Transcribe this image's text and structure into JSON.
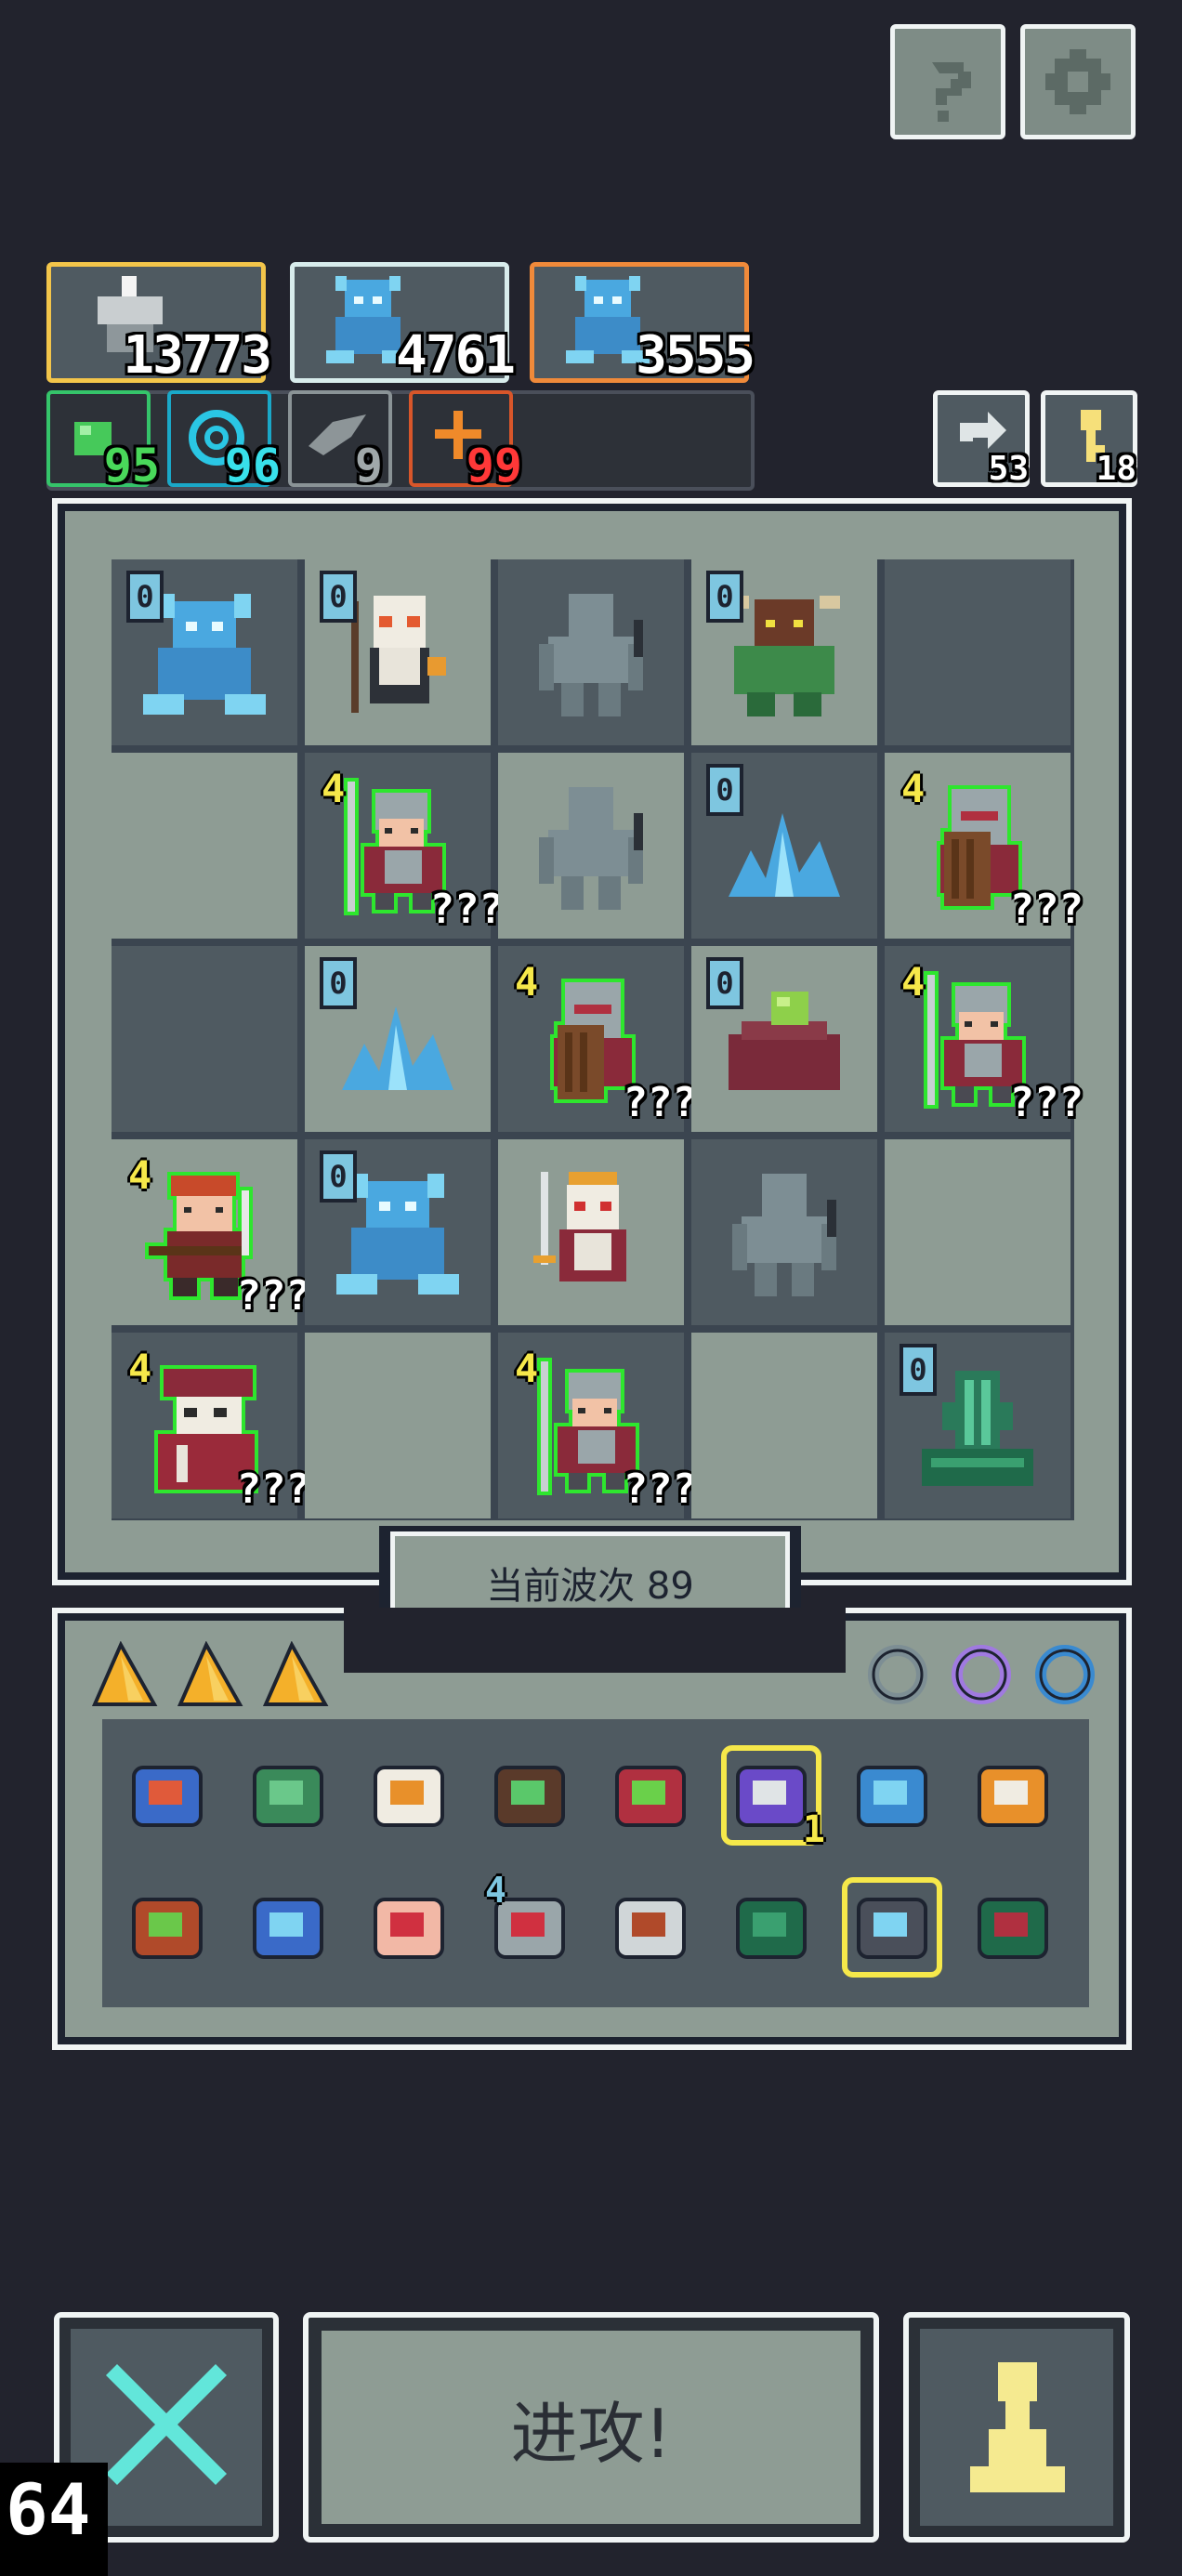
{
  "top_buttons": {
    "help_icon": "help-icon",
    "settings_icon": "gear-icon"
  },
  "stats": {
    "power": {
      "value": "13773",
      "color": "#f3c54a"
    },
    "blue_a": {
      "value": "4761",
      "color": "#d8ecec"
    },
    "blue_b": {
      "value": "3555",
      "color": "#f08a3a"
    }
  },
  "resources": [
    {
      "name": "green-orb",
      "value": "95",
      "color": "#35c46a",
      "text_color": "#49d85a"
    },
    {
      "name": "cyan-swirl",
      "value": "96",
      "color": "#1aa8c8",
      "text_color": "#38e0ea"
    },
    {
      "name": "grey-wing",
      "value": "9",
      "color": "#8a9396",
      "text_color": "#a0a8aa"
    },
    {
      "name": "orange-spark",
      "value": "99",
      "color": "#d8562a",
      "text_color": "#ff3838"
    }
  ],
  "counters": {
    "refresh": "53",
    "key": "18"
  },
  "board": {
    "wave_label": "当前波次 89",
    "cells": [
      {
        "r": 0,
        "c": 0,
        "shade": "dark",
        "unit": "ice-demon",
        "lvl": "0"
      },
      {
        "r": 0,
        "c": 1,
        "shade": "light",
        "unit": "skull-mage",
        "lvl": "0"
      },
      {
        "r": 0,
        "c": 2,
        "shade": "dark",
        "unit": "stone-golem",
        "lvl": ""
      },
      {
        "r": 0,
        "c": 3,
        "shade": "light",
        "unit": "minotaur",
        "lvl": "0"
      },
      {
        "r": 0,
        "c": 4,
        "shade": "dark",
        "unit": "",
        "lvl": ""
      },
      {
        "r": 1,
        "c": 0,
        "shade": "light",
        "unit": "",
        "lvl": ""
      },
      {
        "r": 1,
        "c": 1,
        "shade": "dark",
        "unit": "spear-knight",
        "lvl": "4",
        "qqq": "???"
      },
      {
        "r": 1,
        "c": 2,
        "shade": "light",
        "unit": "stone-golem",
        "lvl": ""
      },
      {
        "r": 1,
        "c": 3,
        "shade": "dark",
        "unit": "ice-crystal",
        "lvl": "0"
      },
      {
        "r": 1,
        "c": 4,
        "shade": "light",
        "unit": "shield-knight",
        "lvl": "4",
        "qqq": "???"
      },
      {
        "r": 2,
        "c": 0,
        "shade": "dark",
        "unit": "",
        "lvl": ""
      },
      {
        "r": 2,
        "c": 1,
        "shade": "light",
        "unit": "ice-crystal",
        "lvl": "0"
      },
      {
        "r": 2,
        "c": 2,
        "shade": "dark",
        "unit": "shield-knight",
        "lvl": "4",
        "qqq": "???"
      },
      {
        "r": 2,
        "c": 3,
        "shade": "light",
        "unit": "slime-mound",
        "lvl": "0"
      },
      {
        "r": 2,
        "c": 4,
        "shade": "dark",
        "unit": "spear-knight",
        "lvl": "4",
        "qqq": "???"
      },
      {
        "r": 3,
        "c": 0,
        "shade": "light",
        "unit": "crossbow-dwarf",
        "lvl": "4",
        "qqq": "???"
      },
      {
        "r": 3,
        "c": 1,
        "shade": "dark",
        "unit": "ice-demon",
        "lvl": "0"
      },
      {
        "r": 3,
        "c": 2,
        "shade": "light",
        "unit": "skull-king",
        "lvl": ""
      },
      {
        "r": 3,
        "c": 3,
        "shade": "dark",
        "unit": "stone-golem",
        "lvl": ""
      },
      {
        "r": 3,
        "c": 4,
        "shade": "light",
        "unit": "",
        "lvl": ""
      },
      {
        "r": 4,
        "c": 0,
        "shade": "dark",
        "unit": "red-cultist",
        "lvl": "4",
        "qqq": "???"
      },
      {
        "r": 4,
        "c": 1,
        "shade": "light",
        "unit": "",
        "lvl": ""
      },
      {
        "r": 4,
        "c": 2,
        "shade": "dark",
        "unit": "spear-knight",
        "lvl": "4",
        "qqq": "???"
      },
      {
        "r": 4,
        "c": 3,
        "shade": "light",
        "unit": "",
        "lvl": ""
      },
      {
        "r": 4,
        "c": 4,
        "shade": "dark",
        "unit": "jade-serpent",
        "lvl": "0"
      }
    ]
  },
  "inventory": {
    "gold_slots": 3,
    "rings": [
      "grey-ring-icon",
      "purple-ring-icon",
      "blue-ring-icon"
    ],
    "row1": [
      {
        "name": "crab-icon"
      },
      {
        "name": "turtle-shell-icon"
      },
      {
        "name": "scroll-icon"
      },
      {
        "name": "spiky-bush-icon"
      },
      {
        "name": "red-hood-icon"
      },
      {
        "name": "potion-jar-icon",
        "badge": "1",
        "selected": true
      },
      {
        "name": "blue-bird-icon"
      },
      {
        "name": "crown-icon"
      }
    ],
    "row2": [
      {
        "name": "treasure-chest-icon"
      },
      {
        "name": "blue-serpent-icon"
      },
      {
        "name": "palm-eye-icon"
      },
      {
        "name": "stone-tablet-icon",
        "lvl": "4"
      },
      {
        "name": "dagger-icon"
      },
      {
        "name": "green-rune-card-icon"
      },
      {
        "name": "ice-spikes-icon",
        "selected": true
      },
      {
        "name": "red-rune-card-icon"
      }
    ]
  },
  "bottom": {
    "attack_label": "进攻!",
    "fps": "64"
  }
}
